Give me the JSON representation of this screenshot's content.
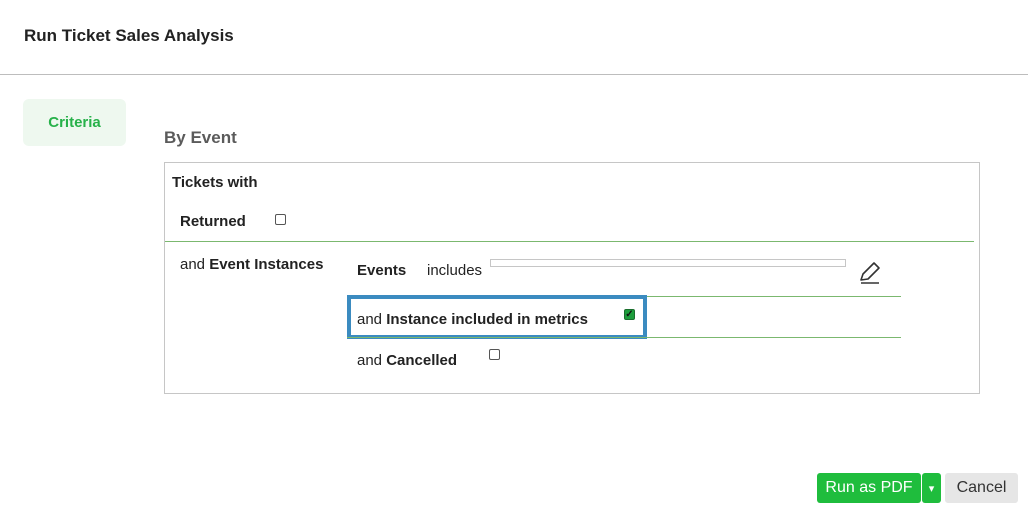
{
  "header": {
    "title": "Run Ticket Sales Analysis"
  },
  "sidebar": {
    "tab_label": "Criteria"
  },
  "main": {
    "section_title": "By Event",
    "criteria": {
      "tickets_with": "Tickets with",
      "returned": {
        "label": "Returned",
        "checked": false
      },
      "event_instances": {
        "prefix": "and",
        "label": "Event Instances"
      },
      "events": {
        "label": "Events",
        "operator": "includes",
        "value": ""
      },
      "instance_included": {
        "prefix": "and",
        "label": "Instance included in metrics",
        "checked": true
      },
      "cancelled": {
        "prefix": "and",
        "label": "Cancelled",
        "checked": false
      }
    }
  },
  "footer": {
    "run_label": "Run as PDF",
    "dropdown_icon": "chevron-down-icon",
    "cancel_label": "Cancel"
  },
  "colors": {
    "accent": "#1fbd3d",
    "highlight": "#3b8bc0",
    "divider": "#7bb86f"
  }
}
